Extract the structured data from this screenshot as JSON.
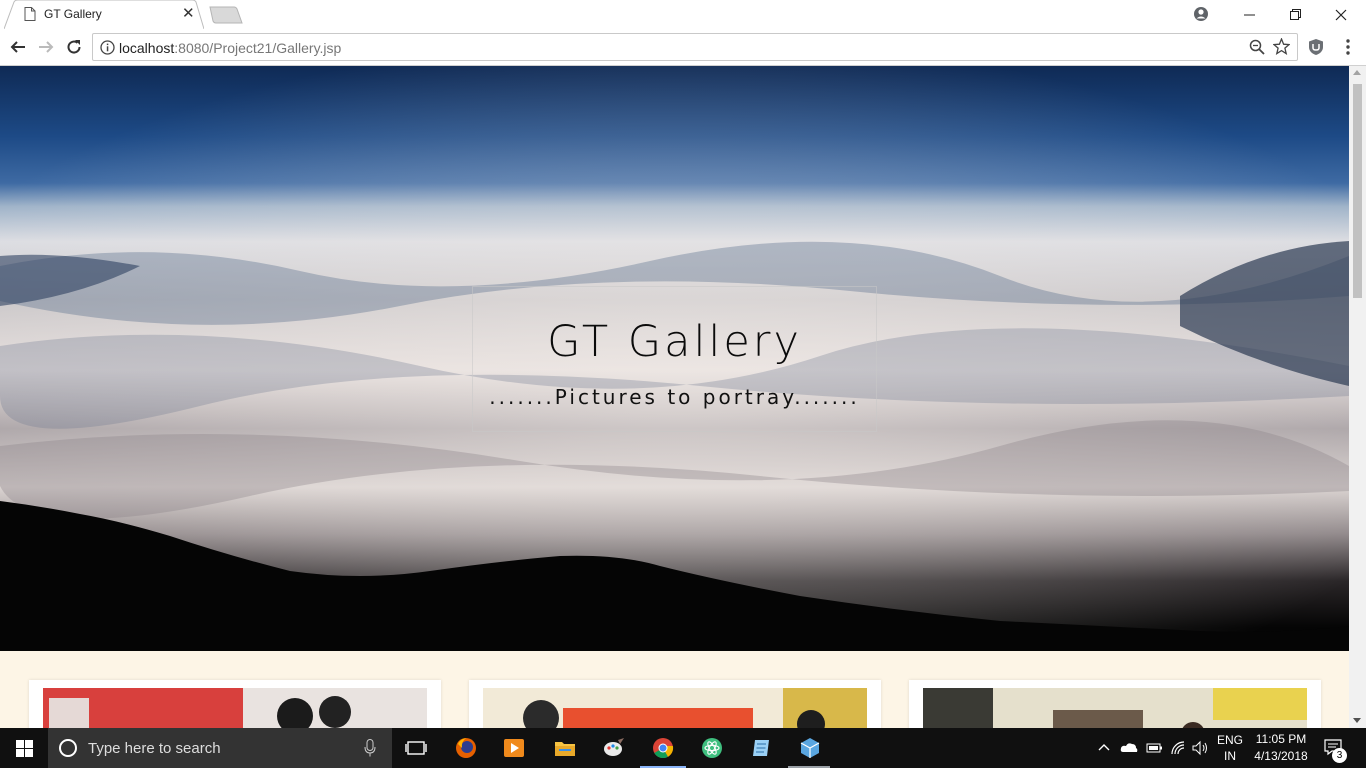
{
  "browser": {
    "tab_title": "GT Gallery",
    "url_host": "localhost",
    "url_rest": ":8080/Project21/Gallery.jsp"
  },
  "hero": {
    "title": "GT Gallery",
    "subtitle": ".......Pictures to portray......."
  },
  "taskbar": {
    "search_placeholder": "Type here to search",
    "language": "ENG",
    "region": "IN",
    "time": "11:05 PM",
    "date": "4/13/2018",
    "notification_count": "3"
  },
  "colors": {
    "page_background": "#fdf5e6",
    "taskbar": "#101010"
  }
}
